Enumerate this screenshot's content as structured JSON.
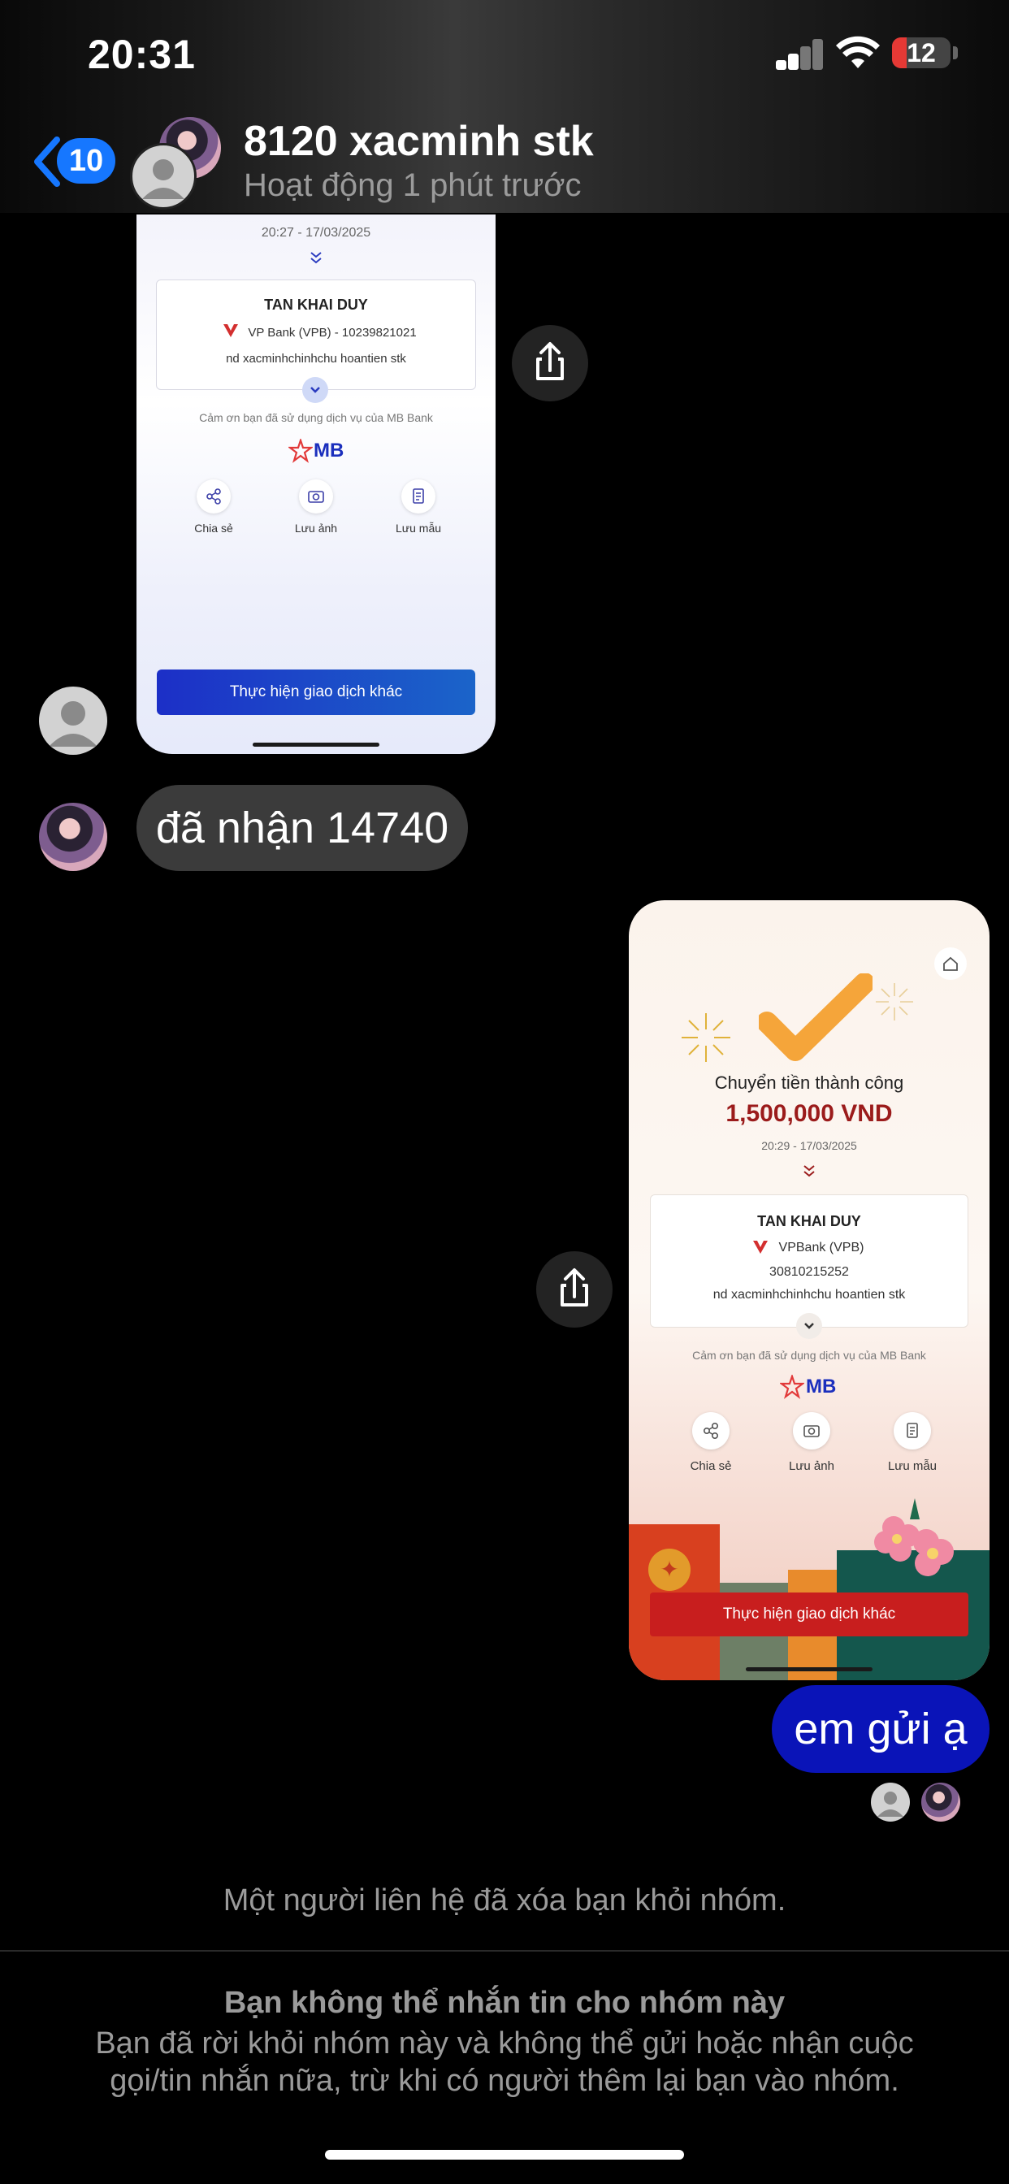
{
  "status_bar": {
    "time": "20:31",
    "battery": "12"
  },
  "header": {
    "back_badge": "10",
    "group_name": "8120 xacminh stk",
    "activity": "Hoạt động 1 phút trước"
  },
  "receipt_1": {
    "datetime": "20:27 - 17/03/2025",
    "recipient": "TAN KHAI DUY",
    "bank_line": "VP Bank (VPB) - 10239821021",
    "note": "nd xacminhchinhchu hoantien stk",
    "thanks": "Cảm ơn bạn đã sử dụng dịch vụ của MB Bank",
    "logo": "MB",
    "actions": [
      "Chia sẻ",
      "Lưu ảnh",
      "Lưu mẫu"
    ],
    "button": "Thực hiện giao dịch khác"
  },
  "msg_received": "đã nhận 14740",
  "receipt_2": {
    "title": "Chuyển tiền thành công",
    "amount": "1,500,000 VND",
    "datetime": "20:29 - 17/03/2025",
    "recipient": "TAN KHAI DUY",
    "bank": "VPBank (VPB)",
    "account": "30810215252",
    "note": "nd xacminhchinhchu hoantien stk",
    "thanks": "Cảm ơn bạn đã sử dụng dịch vụ của MB Bank",
    "logo": "MB",
    "actions": [
      "Chia sẻ",
      "Lưu ảnh",
      "Lưu mẫu"
    ],
    "button": "Thực hiện giao dịch khác"
  },
  "msg_sent": "em gửi ạ",
  "system_notice": "Một người liên hệ đã xóa bạn khỏi nhóm.",
  "blocked": {
    "title": "Bạn không thể nhắn tin cho nhóm này",
    "body_line1": "Bạn đã rời khỏi nhóm này và không thể gửi hoặc nhận cuộc",
    "body_line2": "gọi/tin nhắn nữa, trừ khi có người thêm lại bạn vào nhóm."
  },
  "colors": {
    "accent": "#1677ff",
    "sent_bubble": "#0a14b8",
    "mb_blue": "#1b2fbd",
    "amount_red": "#9b1b1b"
  }
}
